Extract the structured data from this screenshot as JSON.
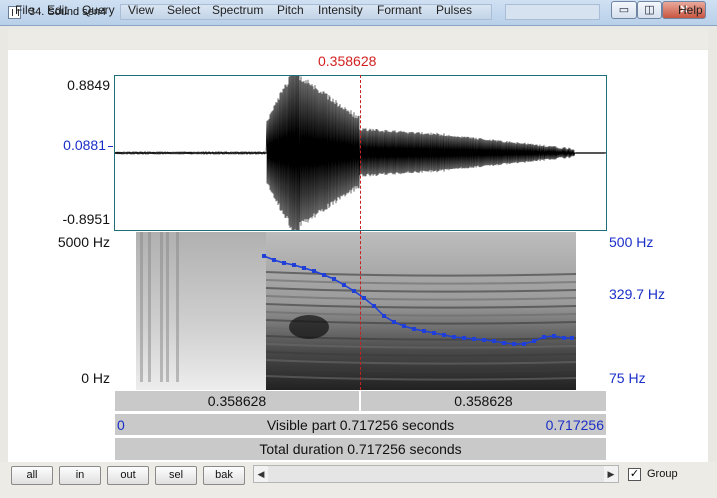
{
  "window": {
    "title": "34. Sound sen4",
    "min_label": "▭",
    "max_label": "◫",
    "close_label": "✕"
  },
  "menu": {
    "items": [
      "File",
      "Edit",
      "Query",
      "View",
      "Select",
      "Spectrum",
      "Pitch",
      "Intensity",
      "Formant",
      "Pulses"
    ],
    "help": "Help"
  },
  "waveform": {
    "cursor_time": "0.358628",
    "y_max": "0.8849",
    "y_mid": "0.0881",
    "y_min": "-0.8951"
  },
  "spectrogram": {
    "freq_max": "5000 Hz",
    "freq_min": "0 Hz",
    "pitch_max": "500 Hz",
    "pitch_cursor": "329.7 Hz",
    "pitch_min": "75 Hz"
  },
  "time_bars": {
    "left_segment": "0.358628",
    "right_segment": "0.358628",
    "visible_start": "0",
    "visible_text": "Visible part 0.717256 seconds",
    "visible_end": "0.717256",
    "total_text": "Total duration 0.717256 seconds"
  },
  "toolbar": {
    "buttons": [
      "all",
      "in",
      "out",
      "sel",
      "bak"
    ],
    "group_label": "Group",
    "group_checked": true
  },
  "colors": {
    "cursor": "#d22020",
    "pitch": "#1f3fd8",
    "axis_blue": "#1a2fc8",
    "frame": "#1f6f78"
  }
}
